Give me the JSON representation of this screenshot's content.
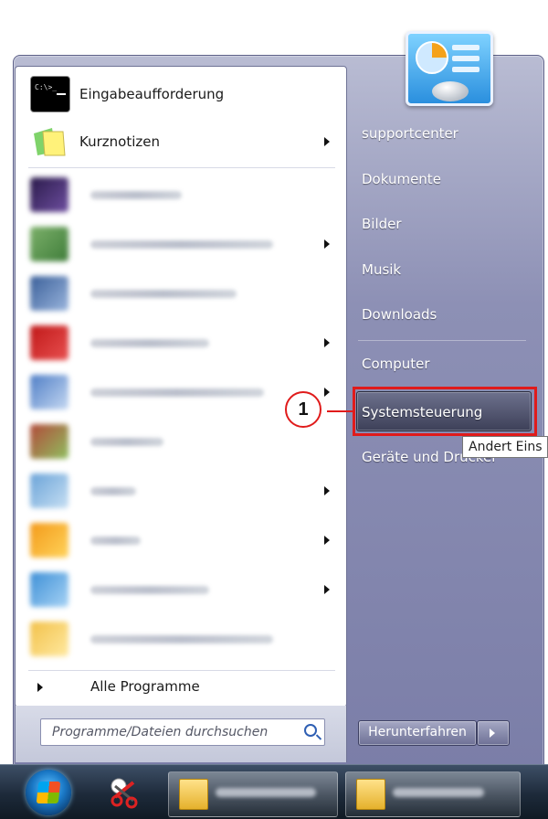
{
  "programs": {
    "pinned": [
      {
        "label": "Eingabeaufforderung",
        "icon": "command-prompt-icon",
        "has_submenu": false
      },
      {
        "label": "Kurznotizen",
        "icon": "sticky-notes-icon",
        "has_submenu": true
      }
    ],
    "recent": [
      {
        "icon": "blurred-app-icon",
        "has_submenu": false
      },
      {
        "icon": "blurred-app-icon",
        "has_submenu": true
      },
      {
        "icon": "blurred-app-icon",
        "has_submenu": false
      },
      {
        "icon": "blurred-app-icon",
        "has_submenu": true
      },
      {
        "icon": "blurred-app-icon",
        "has_submenu": true
      },
      {
        "icon": "blurred-app-icon",
        "has_submenu": false
      },
      {
        "icon": "blurred-app-icon",
        "has_submenu": true
      },
      {
        "icon": "blurred-app-icon",
        "has_submenu": true
      },
      {
        "icon": "blurred-app-icon",
        "has_submenu": true
      },
      {
        "icon": "blurred-app-icon",
        "has_submenu": false
      }
    ],
    "all_programs_label": "Alle Programme"
  },
  "search": {
    "placeholder": "Programme/Dateien durchsuchen",
    "icon": "search-icon"
  },
  "right_pane": {
    "items": [
      {
        "label": "supportcenter"
      },
      {
        "label": "Dokumente"
      },
      {
        "label": "Bilder"
      },
      {
        "label": "Musik"
      },
      {
        "label": "Downloads"
      },
      {
        "label": "Computer"
      },
      {
        "label": "Systemsteuerung"
      },
      {
        "label": "Geräte und Drucker"
      }
    ],
    "highlighted": "Systemsteuerung",
    "tooltip": "Andert Eins",
    "shutdown_label": "Herunterfahren"
  },
  "annotation": {
    "callout_number": "1",
    "color": "#e01b1b"
  },
  "colors": {
    "menu_frame": "#8d90b5",
    "highlight": "#3d4058",
    "taskbar": "#1d2a3a"
  }
}
